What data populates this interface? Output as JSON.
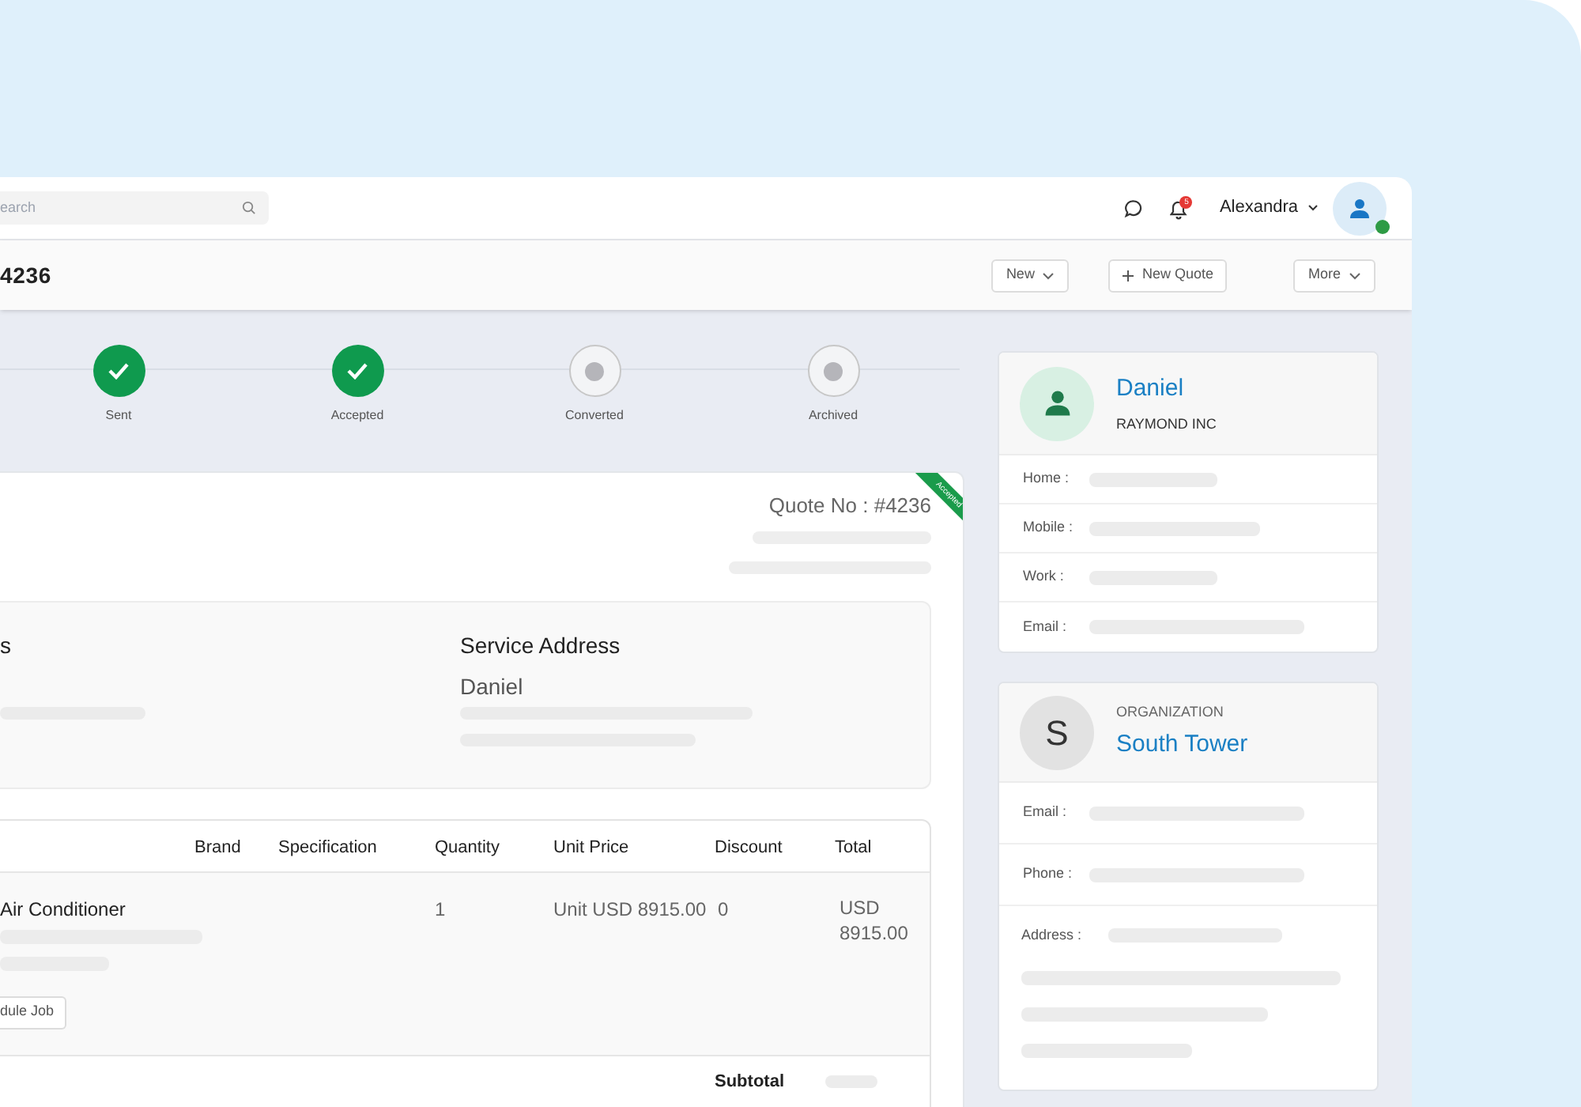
{
  "header": {
    "search": {
      "placeholder": "earch"
    },
    "notifications": {
      "badge": "5"
    },
    "user": {
      "name": "Alexandra",
      "online": true
    }
  },
  "toolbar": {
    "title": "4236",
    "buttons": [
      {
        "label": "New",
        "kind": "dropdown"
      },
      {
        "label": "New Quote",
        "kind": "add"
      },
      {
        "label": "More",
        "kind": "dropdown"
      }
    ]
  },
  "steps": [
    {
      "label": "Sent",
      "completed": true
    },
    {
      "label": "Accepted",
      "completed": true
    },
    {
      "label": "Converted",
      "completed": false
    },
    {
      "label": "Archived",
      "completed": false
    }
  ],
  "quote": {
    "ribbon": "Accepted",
    "number": "Quote No : #4236",
    "addresses": [
      {
        "heading": "s"
      },
      {
        "heading": "Service Address",
        "name": "Daniel"
      }
    ],
    "table": {
      "columns": [
        "Brand",
        "Specification",
        "Quantity",
        "Unit Price",
        "Discount",
        "Total"
      ],
      "rows": [
        {
          "item": "Air Conditioner",
          "action": "dule Job",
          "brand": "",
          "quantity": "1",
          "unit_price": "Unit USD 8915.00",
          "discount": "0",
          "total": "USD 8915.00"
        }
      ],
      "subtotal_label": "Subtotal"
    }
  },
  "contact": {
    "name": "Daniel",
    "company": "RAYMOND INC",
    "fields": [
      "Home :",
      "Mobile :",
      "Work :",
      "Email :"
    ]
  },
  "organization": {
    "initial": "S",
    "caption": "ORGANIZATION",
    "name": "South Tower",
    "fields": [
      "Email :",
      "Phone :",
      "Address :"
    ]
  }
}
